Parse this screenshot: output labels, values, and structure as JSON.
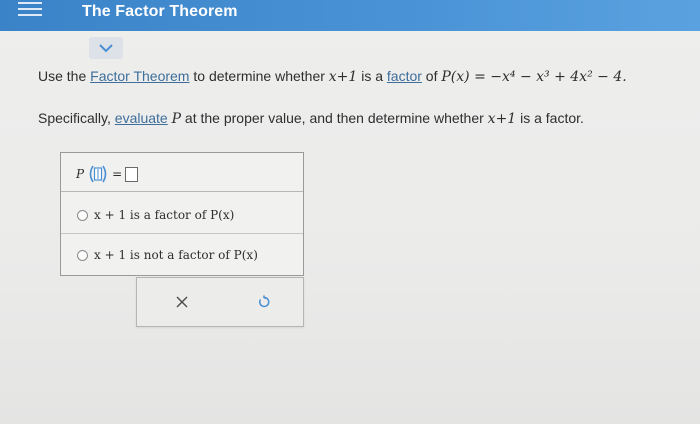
{
  "header": {
    "title": "The Factor Theorem",
    "menu_icon": "hamburger-menu-icon",
    "bar_color": "#4a8fd2"
  },
  "collapse_icon": "chevron-down-icon",
  "question": {
    "line1": {
      "pre": "Use the ",
      "link1": "Factor Theorem",
      "mid1": " to determine whether ",
      "expr1": "x+1",
      "mid2": " is a ",
      "link2": "factor",
      "mid3": " of ",
      "poly": "P(x) = −x⁴ − x³ + 4x² − 4."
    },
    "line2": {
      "pre": "Specifically, ",
      "link": "evaluate",
      "mid1": " ",
      "var": "P",
      "mid2": " at the proper value, and then determine whether ",
      "expr": "x+1",
      "post": " is a factor."
    }
  },
  "answer": {
    "func_letter": "P",
    "equals": "=",
    "options": [
      {
        "label": "x + 1 is a factor of P(x)"
      },
      {
        "label": "x + 1 is not a factor of P(x)"
      }
    ]
  },
  "actions": {
    "clear_icon": "x-icon",
    "undo_icon": "undo-icon",
    "accent": "#4a8fd2"
  }
}
